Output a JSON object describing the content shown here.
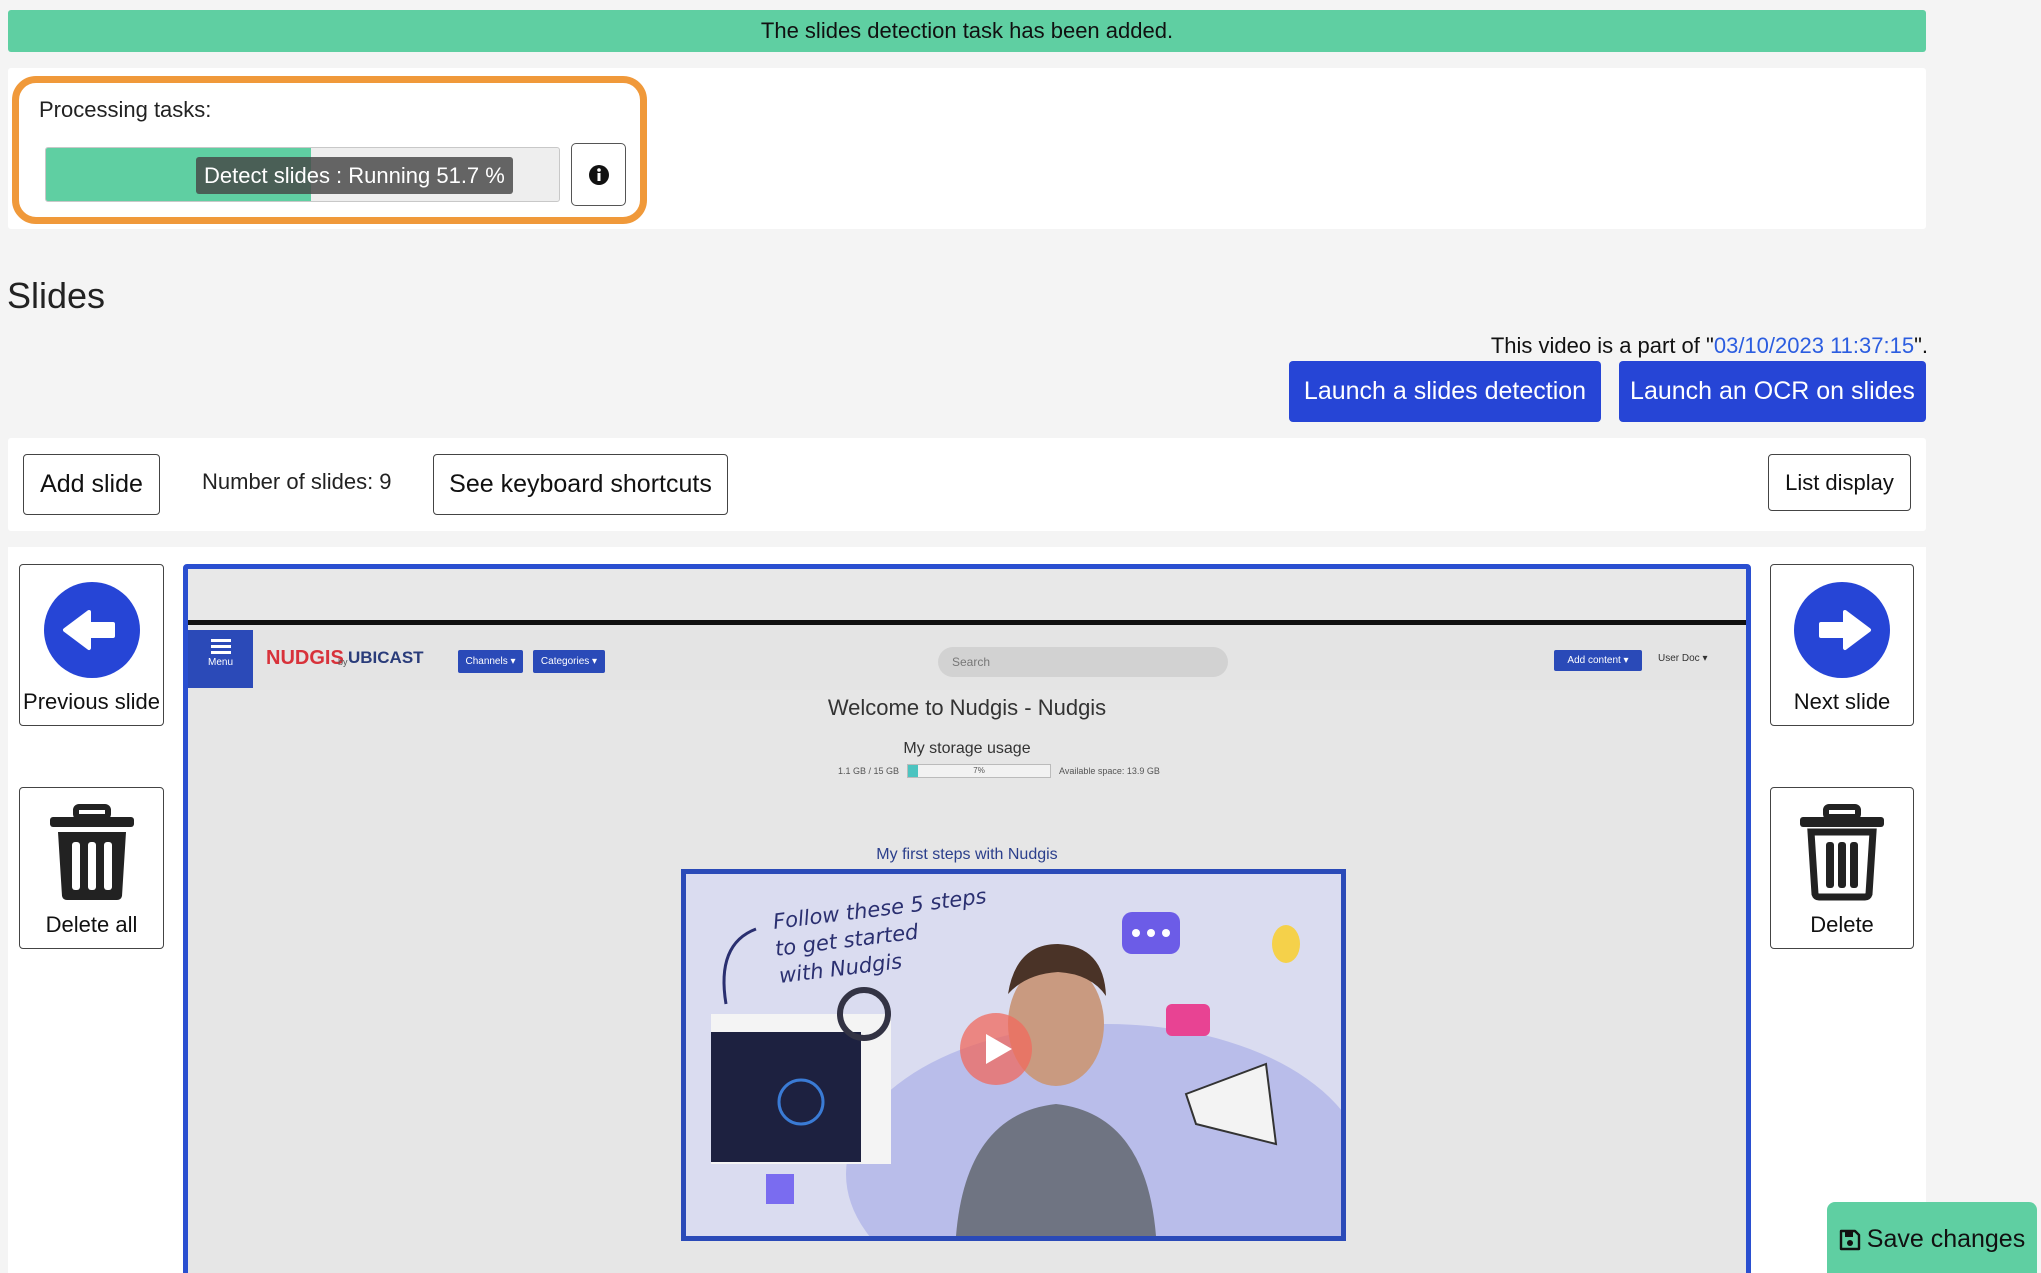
{
  "notice": {
    "text": "The slides detection task has been added."
  },
  "tasks": {
    "label": "Processing tasks:",
    "progress_text": "Detect slides : Running 51.7 %",
    "progress_fraction": 0.517
  },
  "slides": {
    "title": "Slides",
    "part_of_prefix": "This video is a part of \"",
    "part_of_link": "03/10/2023 11:37:15",
    "part_of_suffix": "\".",
    "launch_detection": "Launch a slides detection",
    "launch_ocr": "Launch an OCR on slides"
  },
  "toolbar": {
    "add_slide": "Add slide",
    "count": "Number of slides: 9",
    "shortcuts": "See keyboard shortcuts",
    "list_display": "List display"
  },
  "nav": {
    "previous": "Previous slide",
    "next": "Next slide",
    "delete_all": "Delete all",
    "delete": "Delete"
  },
  "slide_preview": {
    "menu": "Menu",
    "logo": "NUDGIS",
    "by": "by",
    "brand": "UBICAST",
    "channels": "Channels ▾",
    "categories": "Categories ▾",
    "search_placeholder": "Search",
    "add_content": "Add content ▾",
    "user": "User Doc ▾",
    "welcome": "Welcome to Nudgis - Nudgis",
    "storage_title": "My storage usage",
    "storage_used": "1.1 GB / 15 GB",
    "storage_percent": "7%",
    "storage_available": "Available space: 13.9 GB",
    "first_steps": "My first steps with Nudgis",
    "video_caption_1": "Follow these 5 steps",
    "video_caption_2": "to get started",
    "video_caption_3": "with Nudgis"
  },
  "save": {
    "label": "Save changes"
  },
  "colors": {
    "accent_green": "#5fcfa2",
    "primary_blue": "#2645d6",
    "highlight_orange": "#f0993a",
    "link_blue": "#2b5de0"
  }
}
